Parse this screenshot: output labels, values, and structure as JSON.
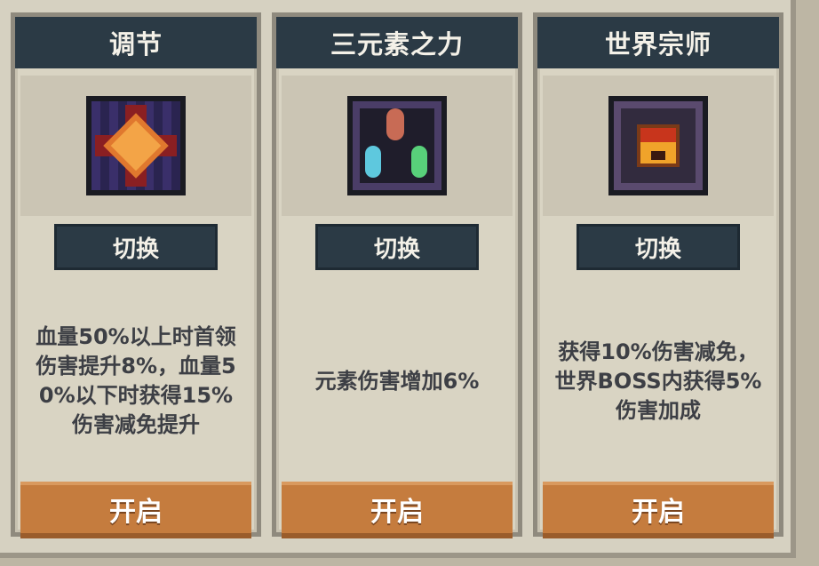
{
  "cards": [
    {
      "title": "调节",
      "icon": "cross-glow-icon",
      "switch_label": "切换",
      "description": "血量50%以上时首领\n伤害提升8%，血量5\n0%以下时获得15%\n伤害减免提升",
      "open_label": "开启"
    },
    {
      "title": "三元素之力",
      "icon": "three-gems-icon",
      "switch_label": "切换",
      "description": "元素伤害增加6%",
      "open_label": "开启"
    },
    {
      "title": "世界宗师",
      "icon": "chest-icon",
      "switch_label": "切换",
      "description": "获得10%伤害减免，\n世界BOSS内获得5%\n伤害加成",
      "open_label": "开启"
    }
  ],
  "colors": {
    "header": "#2b3a45",
    "open_button": "#c57c3e",
    "panel": "#d9d4c3"
  }
}
